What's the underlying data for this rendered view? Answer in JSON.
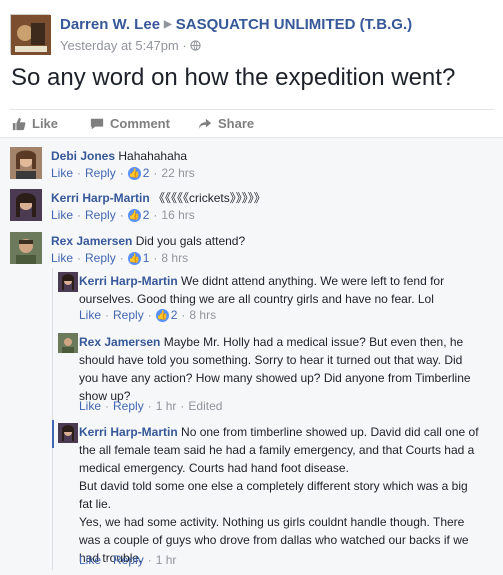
{
  "post": {
    "author": "Darren W. Lee",
    "group": "SASQUATCH UNLIMITED (T.B.G.)",
    "timestamp": "Yesterday at 5:47pm",
    "text": "So any word on how the expedition went?"
  },
  "actions": {
    "like": "Like",
    "comment": "Comment",
    "share": "Share"
  },
  "comments": [
    {
      "name": "Debi Jones",
      "text": "Hahahahaha",
      "like": "Like",
      "reply": "Reply",
      "likes": "2",
      "time": "22 hrs"
    },
    {
      "name": "Kerri Harp-Martin",
      "text": "《《《《《crickets》》》》》",
      "like": "Like",
      "reply": "Reply",
      "likes": "2",
      "time": "16 hrs"
    },
    {
      "name": "Rex Jamersen",
      "text": "Did you gals attend?",
      "like": "Like",
      "reply": "Reply",
      "likes": "1",
      "time": "8 hrs"
    }
  ],
  "replies": [
    {
      "name": "Kerri Harp-Martin",
      "text": "We didnt attend anything. We were left to fend for ourselves. Good thing we are all country girls and have no fear. Lol",
      "like": "Like",
      "reply": "Reply",
      "likes": "2",
      "time": "8 hrs"
    },
    {
      "name": "Rex Jamersen",
      "text": "Maybe Mr. Holly had a medical issue? But even then, he should have told you something. Sorry to hear it turned out that way. Did you have any action? How many showed up? Did anyone from Timberline show up?",
      "like": "Like",
      "reply": "Reply",
      "time": "1 hr",
      "edited": "Edited"
    },
    {
      "name": "Kerri Harp-Martin",
      "text1": "No one from timberline showed up. David did call one of the all female team said he had a family emergency, and that Courts had a medical emergency. Courts had hand foot disease.",
      "text2": "But david told some one else a completely different story which was a big fat lie.",
      "text3": "Yes, we had some activity. Nothing us girls couldnt handle though. There was a couple of guys who drove from dallas who watched our backs if we had trouble.",
      "like": "Like",
      "reply": "Reply",
      "time": "1 hr"
    }
  ],
  "colors": {
    "link": "#365899",
    "meta": "#90949c",
    "likeBadge": "#5890ff",
    "commentsBg": "#f6f7f9"
  },
  "icons": {
    "like": "thumbs-up-icon",
    "comment": "comment-bubble-icon",
    "share": "share-arrow-icon",
    "privacy": "globe-icon"
  }
}
